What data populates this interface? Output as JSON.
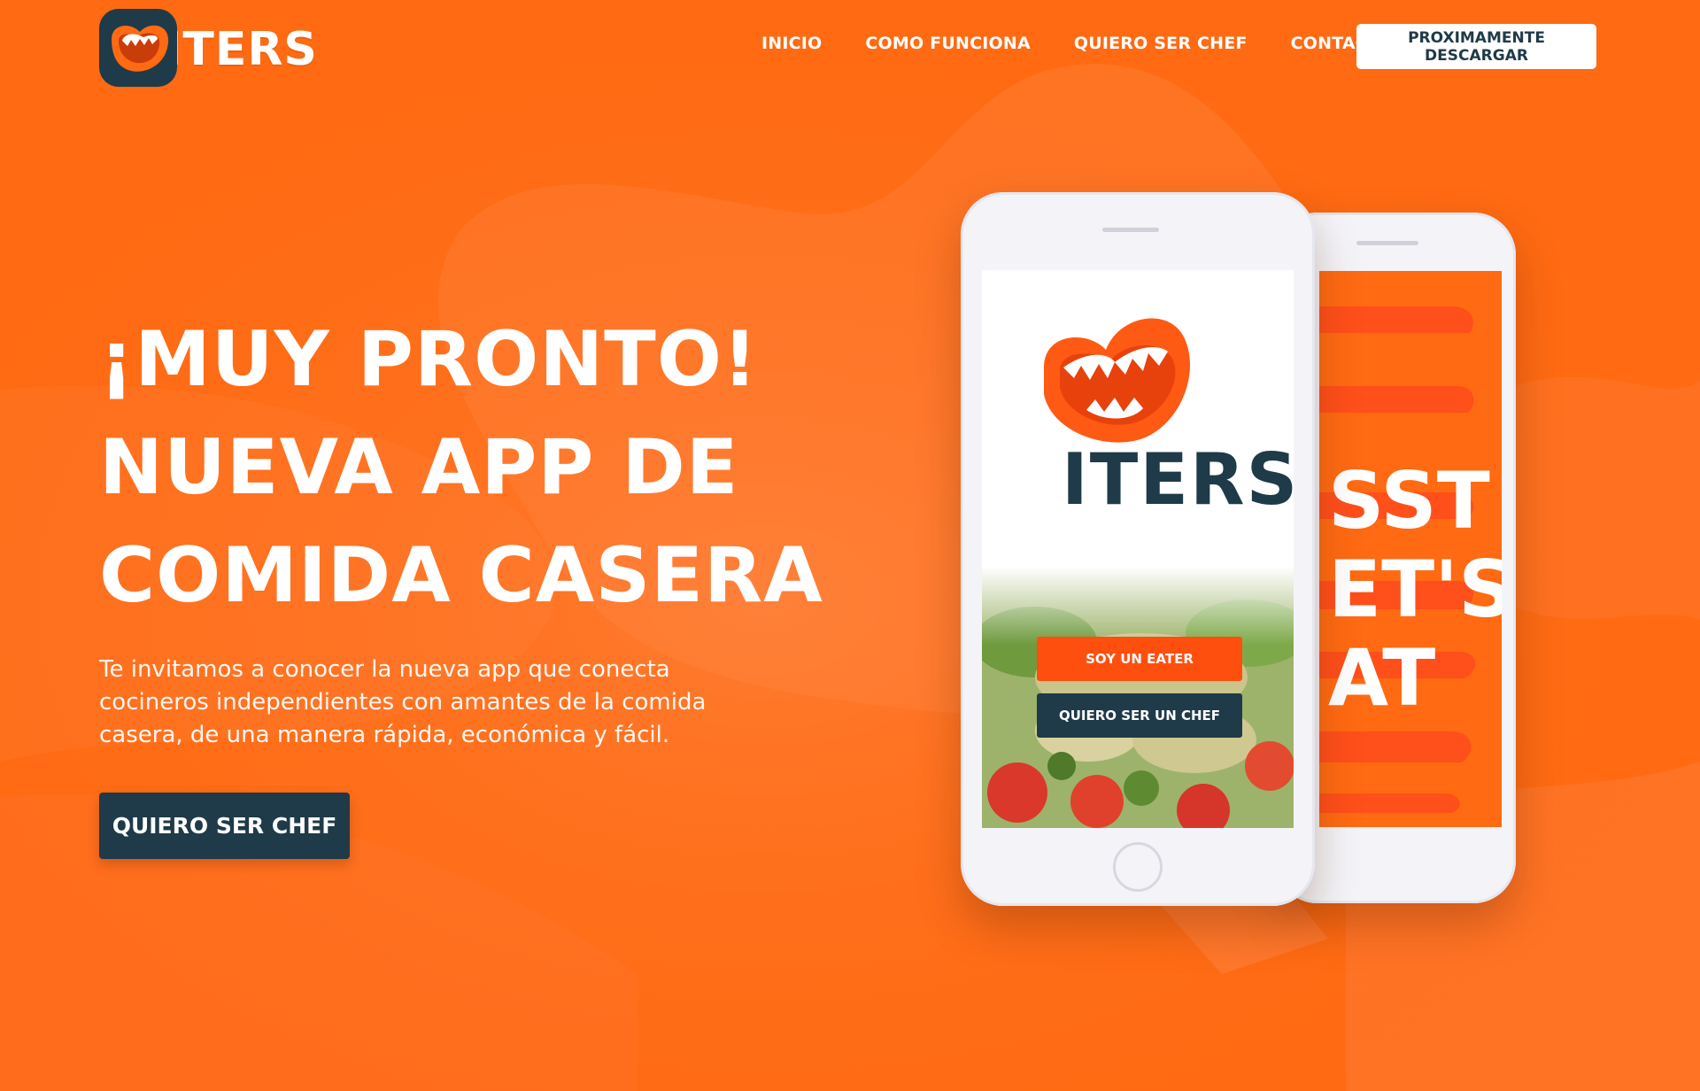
{
  "brand": {
    "name": "ITERS",
    "colors": {
      "primary_orange": "#ff6a12",
      "dark_navy": "#1f3a48",
      "white": "#ffffff",
      "accent_red": "#ff4f0f"
    }
  },
  "nav": {
    "items": [
      {
        "label": "INICIO"
      },
      {
        "label": "COMO FUNCIONA"
      },
      {
        "label": "QUIERO SER CHEF"
      },
      {
        "label": "CONTACTANOS"
      }
    ],
    "cta_label": "PROXIMAMENTE DESCARGAR"
  },
  "hero": {
    "title_lines": [
      "¡MUY PRONTO!",
      "NUEVA APP DE",
      "COMIDA CASERA"
    ],
    "description": "Te invitamos a conocer la nueva app que conecta cocineros independientes con amantes de la comida casera, de una manera rápida, económica y fácil.",
    "cta_label": "QUIERO SER CHEF"
  },
  "phone_front": {
    "app_name": "ITERS",
    "eater_button": "SOY UN EATER",
    "chef_button": "QUIERO SER UN CHEF"
  },
  "phone_back": {
    "text_lines": [
      "SST",
      "ET'S",
      "AT"
    ]
  }
}
